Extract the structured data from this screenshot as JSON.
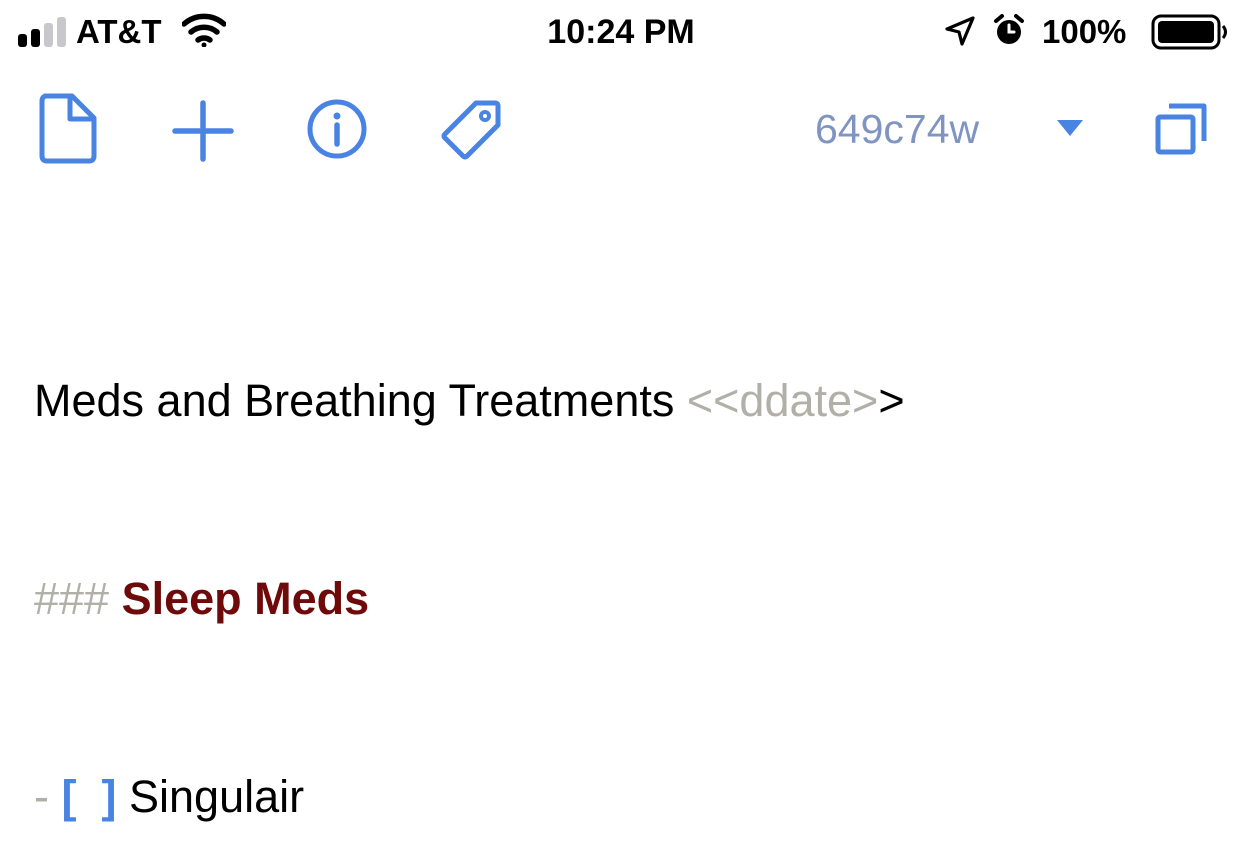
{
  "status_bar": {
    "carrier": "AT&T",
    "time": "10:24 PM",
    "battery_percent": "100%",
    "battery_level": 1.0,
    "signal_bars": 2,
    "icons": [
      "signal-icon",
      "wifi-icon",
      "location-icon",
      "alarm-icon",
      "battery-icon"
    ]
  },
  "toolbar": {
    "icons": [
      "document-icon",
      "plus-icon",
      "info-icon",
      "tag-icon",
      "dropdown-caret-icon",
      "copy-icon"
    ],
    "commit_label": "649c74w",
    "accent_color": "#4a84e3",
    "commit_color": "#7f94c2"
  },
  "editor": {
    "line1": {
      "text": "Meds and Breathing Treatments ",
      "open": "<<ddate>",
      "close": ">"
    },
    "line2": {
      "marker": "### ",
      "heading": "Sleep Meds"
    },
    "line3": {
      "dash": "- ",
      "open_bracket": "[",
      "space": "  ",
      "close_bracket": "]",
      "item": " Singulair"
    },
    "colors": {
      "muted": "#b1b0a8",
      "heading": "#6e0a0a",
      "bracket": "#4a84e3"
    }
  }
}
